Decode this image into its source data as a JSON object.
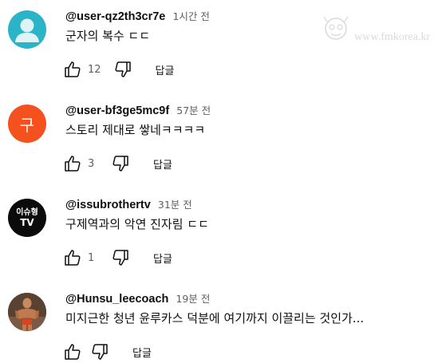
{
  "watermark": {
    "text": "www.fmkorea.kr"
  },
  "comments": [
    {
      "author": "@user-qz2th3cr7e",
      "time": "1시간 전",
      "text": "군자의 복수 ㄷㄷ",
      "likes": "12",
      "reply_label": "답글",
      "avatar": {
        "type": "default-user",
        "color": "#2bb3c8"
      }
    },
    {
      "author": "@user-bf3ge5mc9f",
      "time": "57분 전",
      "text": "스토리 제대로 쌓네ㅋㅋㅋㅋ",
      "likes": "3",
      "reply_label": "답글",
      "avatar": {
        "type": "initial",
        "initial": "구",
        "color": "#f4511e"
      }
    },
    {
      "author": "@issubrothertv",
      "time": "31분 전",
      "text": "구제역과의 악연 진자림 ㄷㄷ",
      "likes": "1",
      "reply_label": "답글",
      "avatar": {
        "type": "channel-logo",
        "line1": "이슈형",
        "line2": "TV",
        "color": "#0b0b0b"
      }
    },
    {
      "author": "@Hunsu_leecoach",
      "time": "19분 전",
      "text": "미지근한 청년 윤루카스 덕분에 여기까지 이끌리는 것인가...",
      "likes": "",
      "reply_label": "답글",
      "avatar": {
        "type": "photo",
        "color": "#6a4b37"
      }
    }
  ]
}
